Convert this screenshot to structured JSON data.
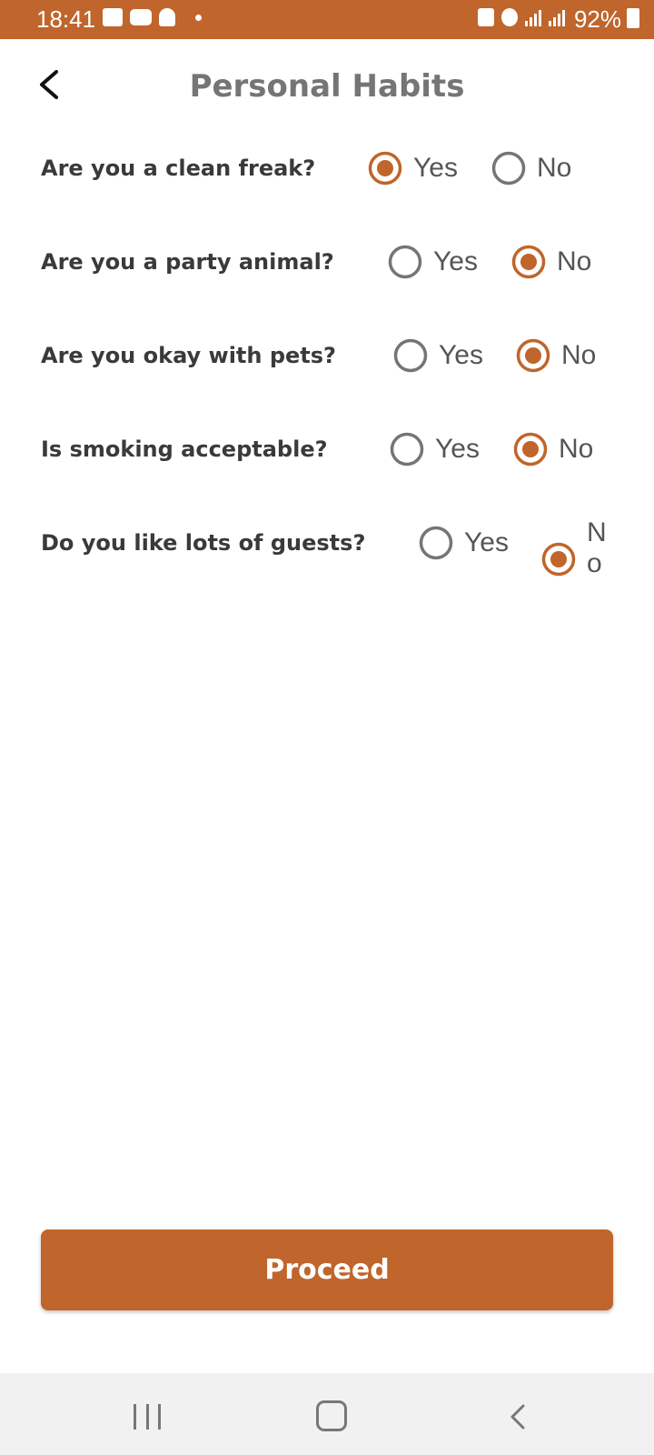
{
  "status_bar": {
    "time": "18:41",
    "battery": "92%",
    "left_icons": [
      "gallery-icon",
      "youtube-icon",
      "snapchat-icon",
      "dot-icon"
    ],
    "right_icons": [
      "lock-icon",
      "alarm-icon",
      "signal-icon",
      "4g-signal-icon",
      "battery-icon"
    ]
  },
  "header": {
    "title": "Personal Habits",
    "back_icon": "chevron-left-icon"
  },
  "questions": [
    {
      "label": "Are you a clean freak?",
      "yes": "Yes",
      "no": "No",
      "selected": "Yes"
    },
    {
      "label": "Are you a party animal?",
      "yes": "Yes",
      "no": "No",
      "selected": "No"
    },
    {
      "label": "Are you okay with pets?",
      "yes": "Yes",
      "no": "No",
      "selected": "No"
    },
    {
      "label": "Is smoking acceptable?",
      "yes": "Yes",
      "no": "No",
      "selected": "No"
    },
    {
      "label": "Do you like lots of guests?",
      "yes": "Yes",
      "no": "No",
      "selected": "No"
    }
  ],
  "proceed_label": "Proceed",
  "nav": {
    "recent_icon": "recent-apps-icon",
    "home_icon": "home-icon",
    "back_icon": "back-icon"
  },
  "colors": {
    "accent": "#C0652B",
    "radio_unselected": "#757575",
    "title": "#757575"
  }
}
